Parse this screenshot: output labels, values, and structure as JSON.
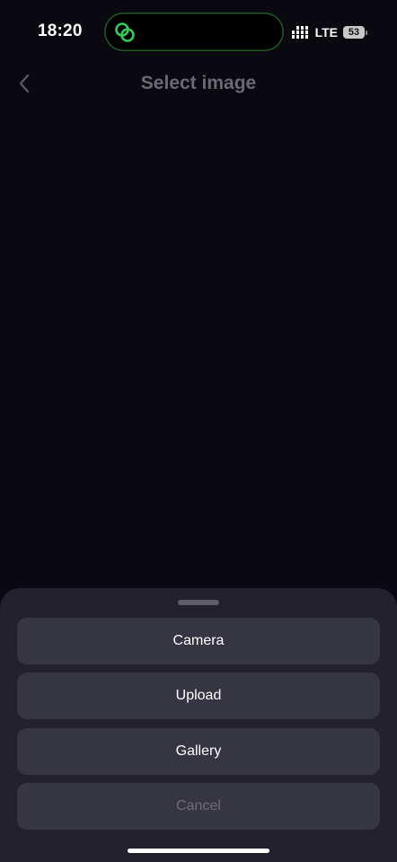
{
  "status_bar": {
    "time": "18:20",
    "network": "LTE",
    "battery_level": "53",
    "island_icon": "link-rings-icon",
    "island_accent": "#35c759"
  },
  "nav": {
    "title": "Select image",
    "back_icon": "chevron-left-icon"
  },
  "sheet": {
    "options": {
      "camera": "Camera",
      "upload": "Upload",
      "gallery": "Gallery"
    },
    "cancel": "Cancel"
  }
}
